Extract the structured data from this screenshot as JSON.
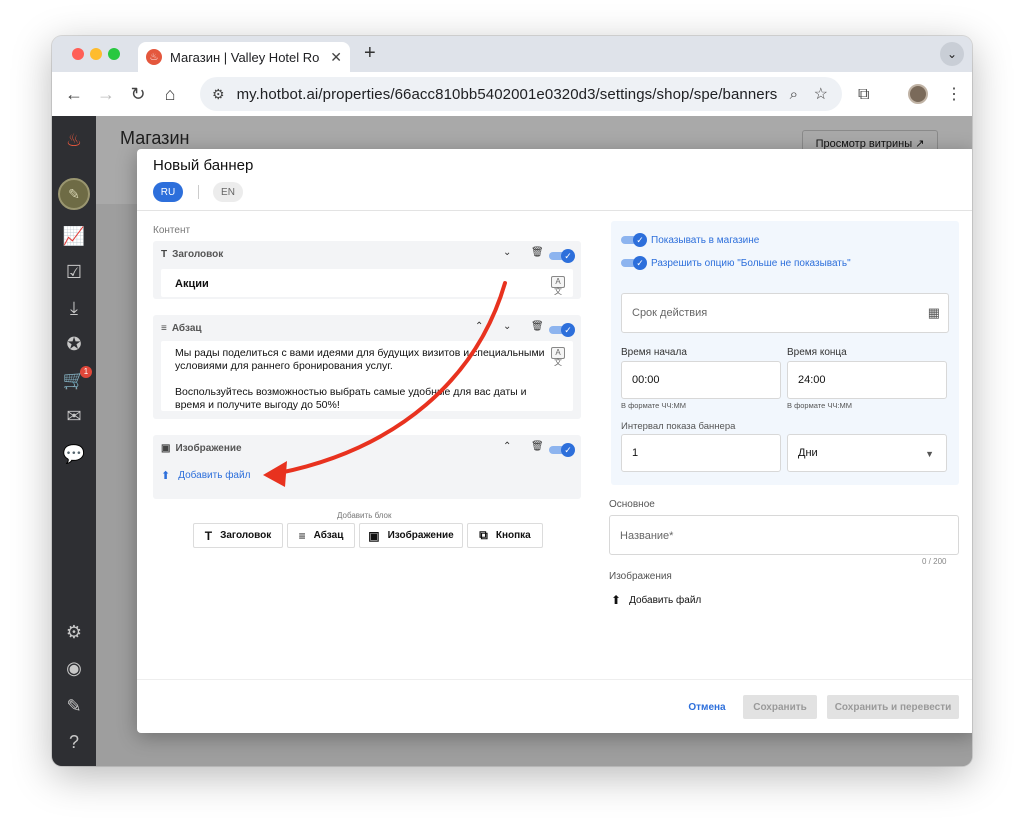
{
  "browser": {
    "tab_title": "Магазин | Valley Hotel Rosa K",
    "url": "my.hotbot.ai/properties/66acc810bb5402001e0320d3/settings/shop/spe/banners"
  },
  "page": {
    "title": "Магазин",
    "preview_button": "Просмотр витрины ↗"
  },
  "sidebar": {
    "cart_badge": "1"
  },
  "modal": {
    "title": "Новый баннер",
    "lang_ru": "RU",
    "lang_en": "EN",
    "content_label": "Контент",
    "heading_block": {
      "label": "Заголовок",
      "value": "Акции",
      "enabled": true
    },
    "paragraph_block": {
      "label": "Абзац",
      "line1": "Мы рады поделиться с вами идеями для будущих визитов и специальными условиями для раннего бронирования услуг.",
      "line2": "Воспользуйтесь возможностью выбрать самые удобные для вас даты и время и получите выгоду до 50%!",
      "enabled": true
    },
    "image_block": {
      "label": "Изображение",
      "add_file": "Добавить файл",
      "enabled": true
    },
    "add_block_label": "Добавить блок",
    "add_block_buttons": {
      "heading": "Заголовок",
      "paragraph": "Абзац",
      "image": "Изображение",
      "button": "Кнопка"
    },
    "settings": {
      "show_in_shop": "Показывать в магазине",
      "allow_dont_show": "Разрешить опцию \"Больше не показывать\"",
      "validity_placeholder": "Срок действия",
      "start_label": "Время начала",
      "start_value": "00:00",
      "start_hint": "В формате ЧЧ:ММ",
      "end_label": "Время конца",
      "end_value": "24:00",
      "end_hint": "В формате ЧЧ:ММ",
      "interval_label": "Интервал показа баннера",
      "interval_value": "1",
      "interval_unit": "Дни"
    },
    "main": {
      "label": "Основное",
      "name_placeholder": "Название*",
      "counter": "0 / 200",
      "images_label": "Изображения",
      "add_file": "Добавить файл"
    },
    "footer": {
      "cancel": "Отмена",
      "save": "Сохранить",
      "save_translate": "Сохранить и перевести"
    }
  },
  "colors": {
    "accent": "#2d6fdb",
    "annotation_arrow": "#e8321f"
  }
}
